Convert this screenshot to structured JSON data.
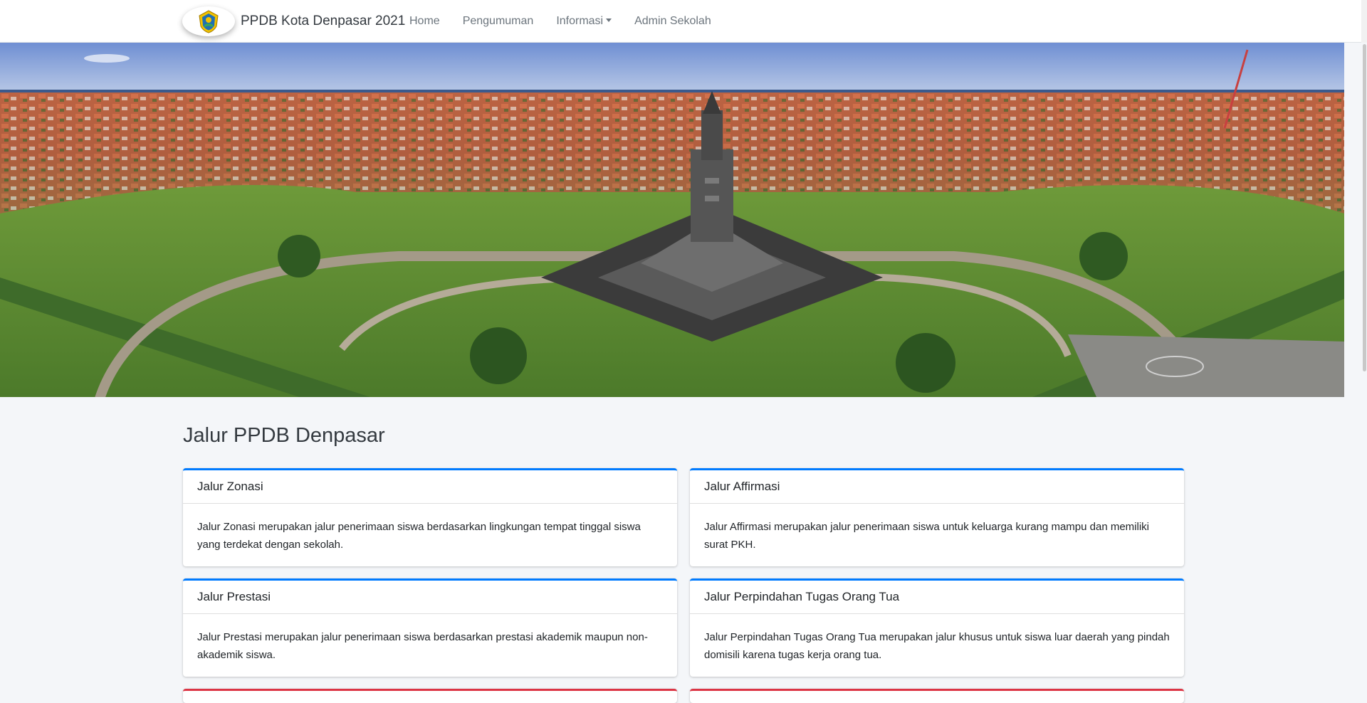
{
  "navbar": {
    "brand": "PPDB Kota Denpasar 2021",
    "logo_icon": "city-emblem-icon",
    "links": [
      "Home",
      "Pengumuman",
      "Informasi",
      "Admin Sekolah"
    ]
  },
  "hero": {
    "image": "aerial-bajra-sandhi-monument-photo"
  },
  "section": {
    "title": "Jalur PPDB Denpasar"
  },
  "cards": [
    {
      "title": "Jalur Zonasi",
      "body": "Jalur Zonasi merupakan jalur penerimaan siswa berdasarkan lingkungan tempat tinggal siswa yang terdekat dengan sekolah."
    },
    {
      "title": "Jalur Affirmasi",
      "body": "Jalur Affirmasi merupakan jalur penerimaan siswa untuk keluarga kurang mampu dan memiliki surat PKH."
    },
    {
      "title": "Jalur Prestasi",
      "body": "Jalur Prestasi merupakan jalur penerimaan siswa berdasarkan prestasi akademik maupun non-akademik siswa."
    },
    {
      "title": "Jalur Perpindahan Tugas Orang Tua",
      "body": "Jalur Perpindahan Tugas Orang Tua merupakan jalur khusus untuk siswa luar daerah yang pindah domisili karena tugas kerja orang tua."
    }
  ],
  "colors": {
    "primary": "#007bff",
    "danger": "#dc3545",
    "background": "#f4f6f9"
  }
}
